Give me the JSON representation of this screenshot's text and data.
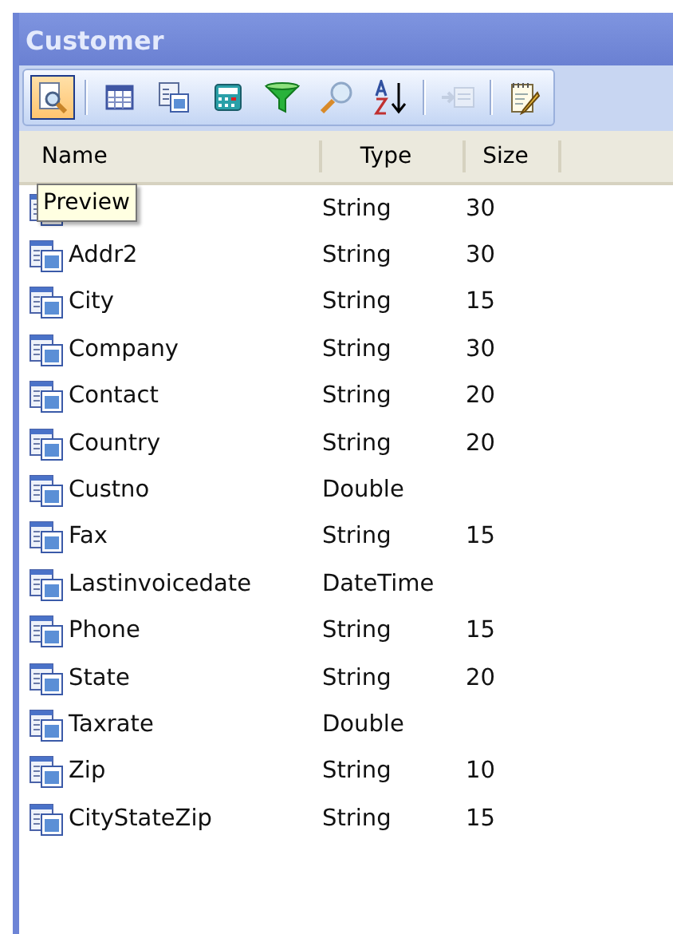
{
  "window": {
    "title": "Customer"
  },
  "toolbar": [
    {
      "kind": "preview",
      "selected": true,
      "disabled": false
    },
    {
      "kind": "separator"
    },
    {
      "kind": "table",
      "selected": false,
      "disabled": false
    },
    {
      "kind": "form",
      "selected": false,
      "disabled": false
    },
    {
      "kind": "calculator",
      "selected": false,
      "disabled": false
    },
    {
      "kind": "filter",
      "selected": false,
      "disabled": false
    },
    {
      "kind": "search",
      "selected": false,
      "disabled": false
    },
    {
      "kind": "sort",
      "selected": false,
      "disabled": false
    },
    {
      "kind": "separator"
    },
    {
      "kind": "insert",
      "selected": false,
      "disabled": true
    },
    {
      "kind": "separator"
    },
    {
      "kind": "notepad",
      "selected": false,
      "disabled": false
    }
  ],
  "tooltip": "Preview",
  "table": {
    "columns": [
      "Name",
      "Type",
      "Size"
    ],
    "rows": [
      {
        "type": "String",
        "size": "30"
      },
      {
        "name": "Addr2",
        "type": "String",
        "size": "30"
      },
      {
        "name": "City",
        "type": "String",
        "size": "15"
      },
      {
        "name": "Company",
        "type": "String",
        "size": "30"
      },
      {
        "name": "Contact",
        "type": "String",
        "size": "20"
      },
      {
        "name": "Country",
        "type": "String",
        "size": "20"
      },
      {
        "name": "Custno",
        "type": "Double"
      },
      {
        "name": "Fax",
        "type": "String",
        "size": "15"
      },
      {
        "name": "Lastinvoicedate",
        "type": "DateTime"
      },
      {
        "name": "Phone",
        "type": "String",
        "size": "15"
      },
      {
        "name": "State",
        "type": "String",
        "size": "20"
      },
      {
        "name": "Taxrate",
        "type": "Double"
      },
      {
        "name": "Zip",
        "type": "String",
        "size": "10"
      },
      {
        "name": "CityStateZip",
        "type": "String",
        "size": "15"
      }
    ]
  }
}
